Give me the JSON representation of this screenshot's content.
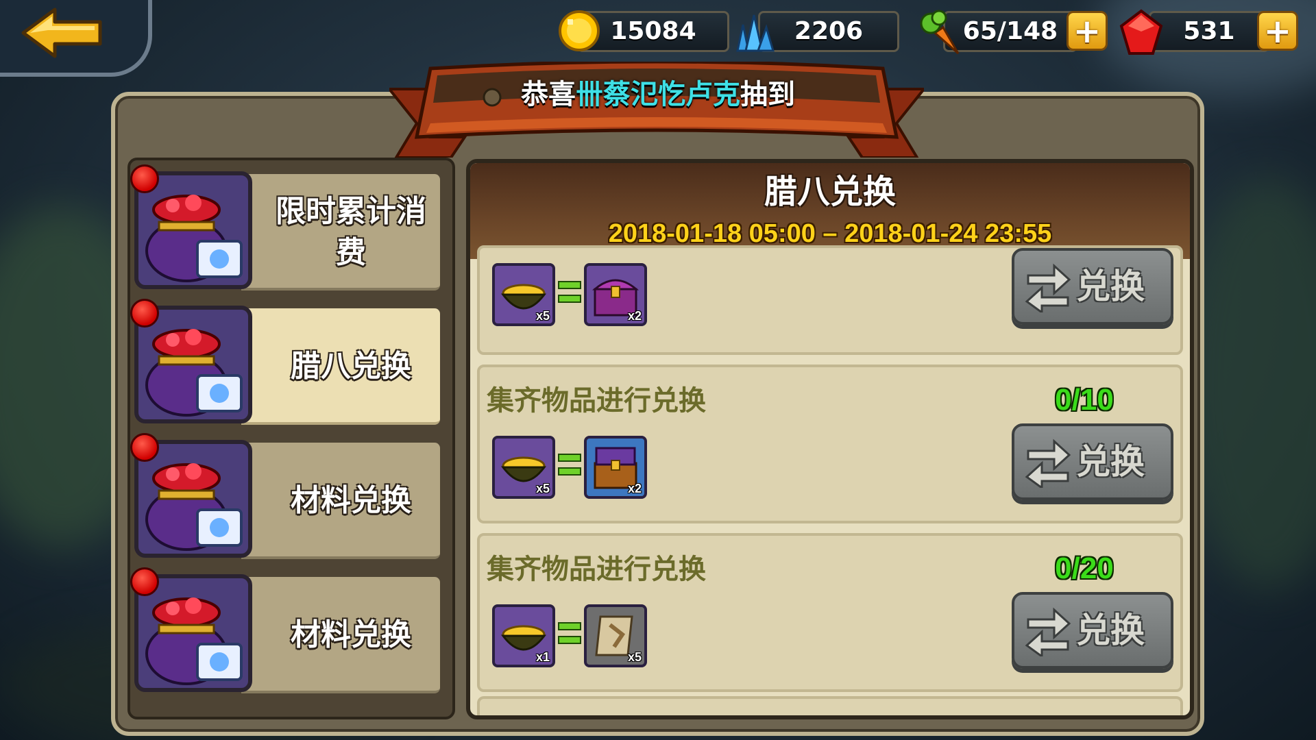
{
  "topbar": {
    "gold": "15084",
    "crystal": "2206",
    "stamina": "65/148",
    "gem": "531"
  },
  "banner": {
    "prefix": "恭喜",
    "player": "卌蔡氾忔卢克",
    "suffix": "抽到"
  },
  "tabs": [
    {
      "label": "限时累计消费",
      "active": false,
      "badge": true
    },
    {
      "label": "腊八兑换",
      "active": true,
      "badge": true
    },
    {
      "label": "材料兑换",
      "active": false,
      "badge": true
    },
    {
      "label": "材料兑换",
      "active": false,
      "badge": true
    }
  ],
  "event": {
    "title": "腊八兑换",
    "date_range": "2018-01-18  05:00 – 2018-01-24  23:55"
  },
  "rows": [
    {
      "title": "",
      "progress": "",
      "input": {
        "icon": "porridge-bowl-icon",
        "count": "x5"
      },
      "output": {
        "icon": "purple-treasure-chest-icon",
        "count": "x2"
      },
      "button": "兑换"
    },
    {
      "title": "集齐物品进行兑换",
      "progress": "0/10",
      "input": {
        "icon": "porridge-bowl-icon",
        "count": "x5"
      },
      "output": {
        "icon": "blue-treasure-chest-icon",
        "count": "x2"
      },
      "button": "兑换"
    },
    {
      "title": "集齐物品进行兑换",
      "progress": "0/20",
      "input": {
        "icon": "porridge-bowl-icon",
        "count": "x1"
      },
      "output": {
        "icon": "scroll-icon",
        "count": "x5"
      },
      "button": "兑换"
    }
  ],
  "colors": {
    "highlight_name": "#3ee0e6",
    "date": "#ffd21a",
    "progress": "#3bdc1a",
    "row_title": "#6b6b2a"
  }
}
